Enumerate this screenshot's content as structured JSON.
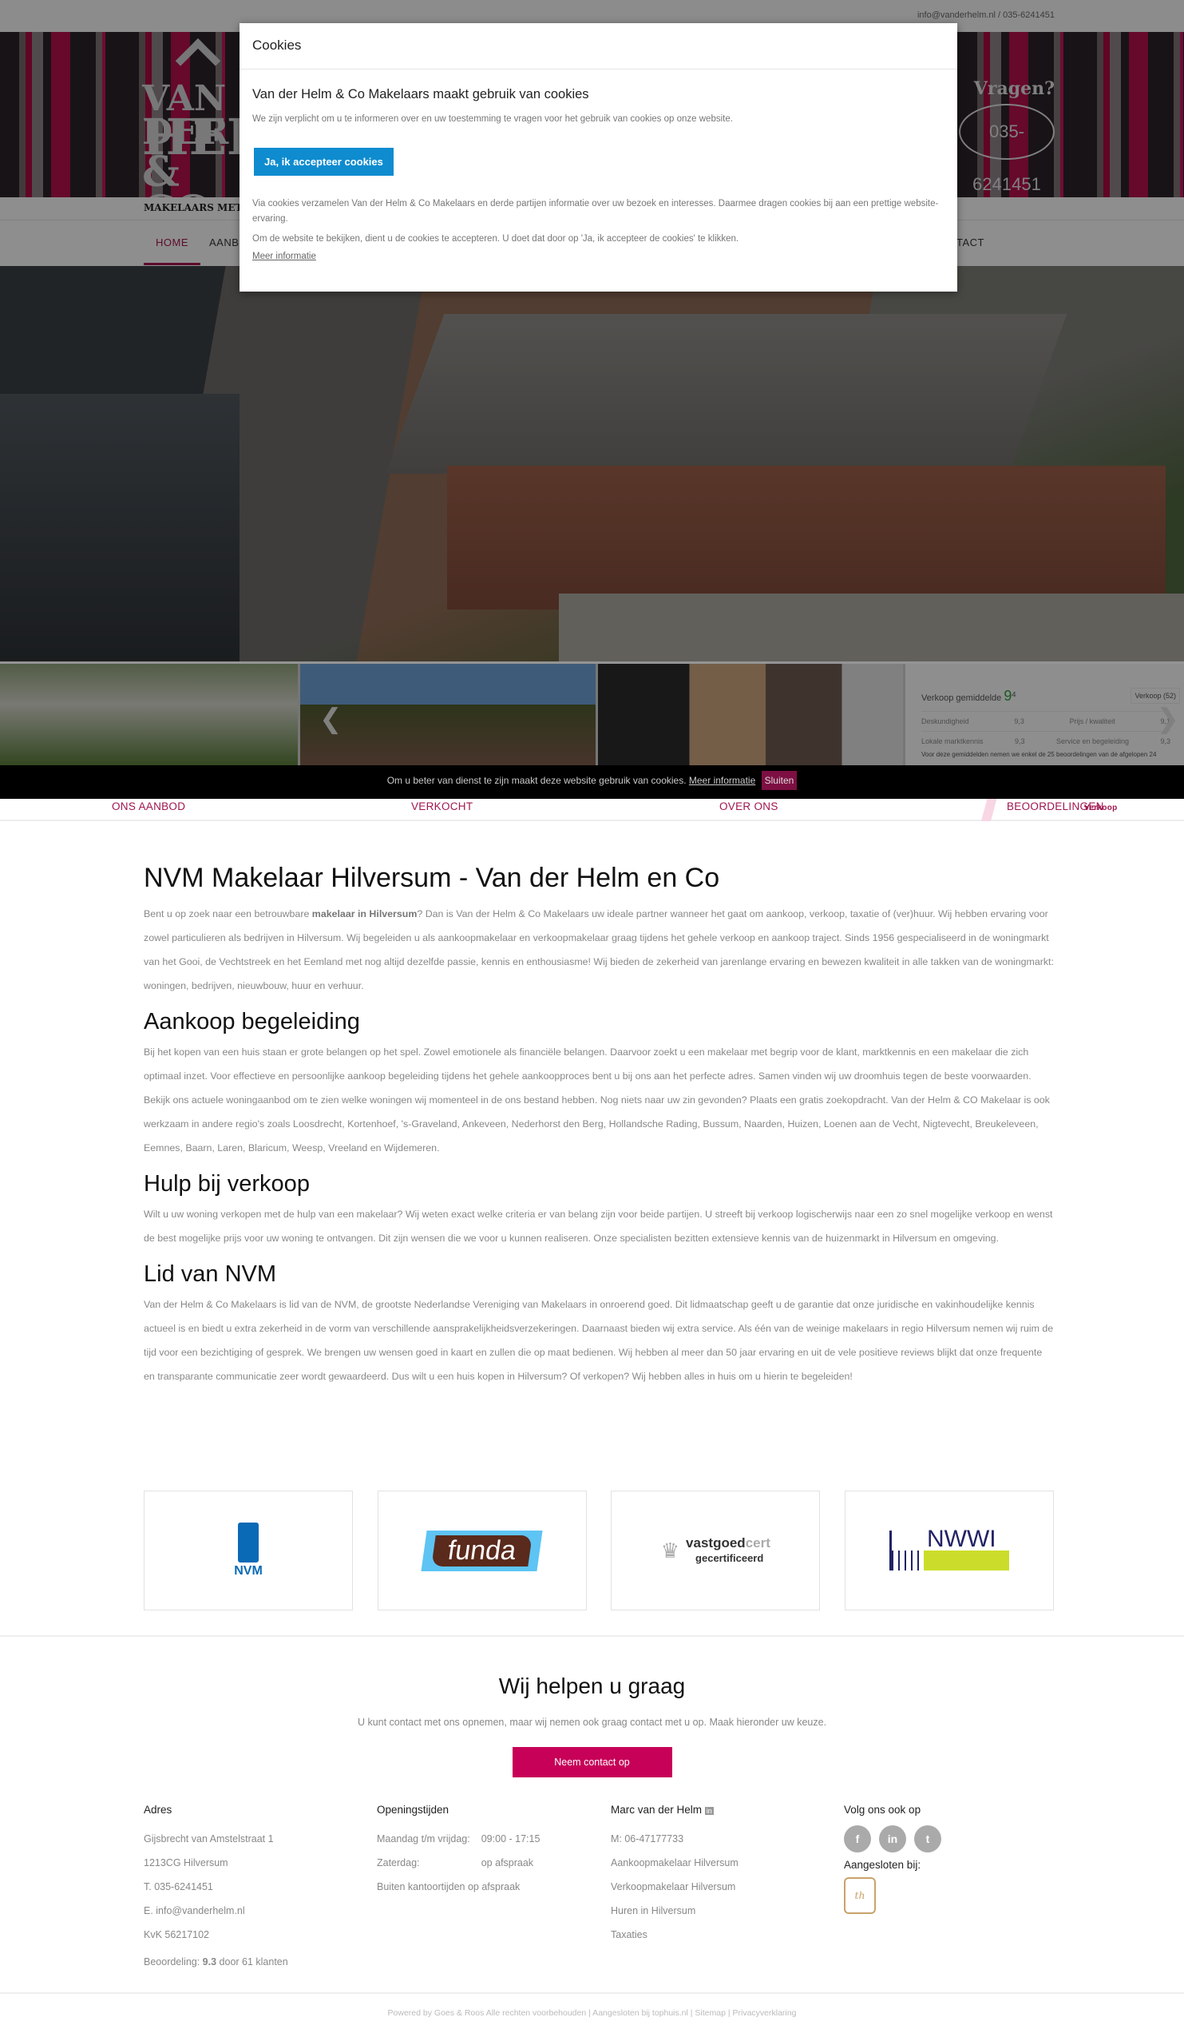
{
  "topbar": {
    "contact": "info@vanderhelm.nl / 035-6241451"
  },
  "header": {
    "logo_lines": [
      "VAN DER",
      "HELM",
      "& CO"
    ],
    "tagline": "MAKELAARS MET M",
    "vragen": "Vragen?",
    "phone": "035-6241451"
  },
  "nav": {
    "items": [
      "HOME",
      "AANB",
      "TACT"
    ]
  },
  "rating_widget": {
    "title": "Verkoop gemiddelde",
    "score": "9",
    "score_dec": "4",
    "tab": "Verkoop (52)",
    "rows": [
      [
        "Deskundigheid",
        "9,3",
        "Prijs / kwaliteit",
        "9,1"
      ],
      [
        "Lokale marktkennis",
        "9,3",
        "Service en begeleiding",
        "9,3"
      ]
    ],
    "note": "Voor deze gemiddelden nemen we enkel de 25 beoordelingen van de afgelopen 24"
  },
  "cookie_modal": {
    "title": "Cookies",
    "heading": "Van der Helm & Co Makelaars maakt gebruik van cookies",
    "intro": "We zijn verplicht om u te informeren over en uw toestemming te vragen voor het gebruik van cookies op onze website.",
    "accept": "Ja, ik accepteer cookies",
    "p1": "Via cookies verzamelen Van der Helm & Co Makelaars en derde partijen informatie over uw bezoek en interesses. Daarmee dragen cookies bij aan een prettige website-ervaring.",
    "p2": "Om de website te bekijken, dient u de cookies te accepteren. U doet dat door op 'Ja, ik accepteer de cookies' te klikken.",
    "more": "Meer informatie"
  },
  "cookie_bar": {
    "text": "Om u beter van dienst te zijn maakt deze website gebruik van cookies.",
    "more": "Meer informatie",
    "close": "Sluiten"
  },
  "slider_labels": [
    "ONS AANBOD",
    "VERKOCHT",
    "OVER ONS",
    "BEOORDELINGEN"
  ],
  "slider_badge": "Verkoop",
  "content": {
    "h1": "NVM Makelaar Hilversum - Van der Helm en Co",
    "p1_a": "Bent u op zoek naar een betrouwbare ",
    "p1_b": "makelaar in Hilversum",
    "p1_c": "? Dan is Van der Helm & Co Makelaars uw ideale partner wanneer het gaat om aankoop, verkoop, taxatie of (ver)huur. Wij hebben ervaring voor zowel particulieren als bedrijven in Hilversum. Wij begeleiden u als aankoopmakelaar en verkoopmakelaar graag tijdens het gehele verkoop en aankoop traject. Sinds 1956 gespecialiseerd in de woningmarkt van het Gooi, de Vechtstreek en het Eemland met nog altijd dezelfde passie, kennis en enthousiasme! Wij bieden de zekerheid van jarenlange ervaring en bewezen kwaliteit in alle takken van de woningmarkt: woningen, bedrijven, nieuwbouw, huur en verhuur.",
    "h2_1": "Aankoop begeleiding",
    "p2": "Bij het kopen van een huis staan er grote belangen op het spel. Zowel emotionele als financiële belangen. Daarvoor zoekt u een makelaar met begrip voor de klant, marktkennis en een makelaar die zich optimaal inzet. Voor effectieve en persoonlijke aankoop begeleiding tijdens het gehele aankoopproces bent u bij ons aan het perfecte adres. Samen vinden wij uw droomhuis tegen de beste voorwaarden. Bekijk ons actuele woningaanbod om te zien welke woningen wij momenteel in de ons bestand hebben. Nog niets naar uw zin gevonden? Plaats een gratis zoekopdracht. Van der Helm & CO Makelaar is ook werkzaam in andere regio's zoals Loosdrecht, Kortenhoef, 's-Graveland, Ankeveen, Nederhorst den Berg, Hollandsche Rading, Bussum, Naarden, Huizen, Loenen aan de Vecht, Nigtevecht, Breukeleveen, Eemnes, Baarn, Laren, Blaricum, Weesp, Vreeland en Wijdemeren.",
    "h2_2": "Hulp bij verkoop",
    "p3": "Wilt u uw woning verkopen met de hulp van een makelaar? Wij weten exact welke criteria er van belang zijn voor beide partijen. U streeft bij verkoop logischerwijs naar een zo snel mogelijke verkoop en wenst de best mogelijke prijs voor uw woning te ontvangen. Dit zijn wensen die we voor u kunnen realiseren. Onze specialisten bezitten extensieve kennis van de huizenmarkt in Hilversum en omgeving.",
    "h2_3": "Lid van NVM",
    "p4": "Van der Helm & Co Makelaars is lid van de NVM, de grootste Nederlandse Vereniging van Makelaars in onroerend goed. Dit lidmaatschap geeft u de garantie dat onze juridische en vakinhoudelijke kennis actueel is en biedt u extra zekerheid in de vorm van verschillende aansprakelijkheidsverzekeringen. Daarnaast bieden wij extra service. Als één van de weinige makelaars in regio Hilversum nemen wij ruim de tijd voor een bezichtiging of gesprek. We brengen uw wensen goed in kaart en zullen die op maat bedienen. Wij hebben al meer dan 50 jaar ervaring en uit de vele positieve reviews blijkt dat onze frequente en transparante communicatie zeer wordt gewaardeerd. Dus wilt u een huis kopen in Hilversum? Of verkopen? Wij hebben alles in huis om u hierin te begeleiden!"
  },
  "logos": {
    "nvm": "NVM",
    "funda": "funda",
    "vastgoed1": "vastgoed",
    "vastgoed2": "cert",
    "vastgoed3": "gecertificeerd",
    "nwwi": "NWWI"
  },
  "help": {
    "title": "Wij helpen u graag",
    "text": "U kunt contact met ons opnemen, maar wij nemen ook graag contact met u op. Maak hieronder uw keuze.",
    "button": "Neem contact op"
  },
  "footer": {
    "address": {
      "title": "Adres",
      "lines": [
        "Gijsbrecht van Amstelstraat 1",
        "1213CG Hilversum",
        "T. 035-6241451",
        "E. info@vanderhelm.nl",
        "KvK 56217102"
      ],
      "rating_label": "Beoordeling: ",
      "rating_value": "9.3",
      "rating_suffix": " door 61 klanten"
    },
    "hours": {
      "title": "Openingstijden",
      "rows": [
        [
          "Maandag t/m vrijdag:",
          "09:00 - 17:15"
        ],
        [
          "Zaterdag:",
          "op afspraak"
        ]
      ],
      "extra": "Buiten kantoortijden op afspraak"
    },
    "marc": {
      "title": "Marc van der Helm",
      "mobile": "M: 06-47177733",
      "links": [
        "Aankoopmakelaar Hilversum",
        "Verkoopmakelaar Hilversum",
        "Huren in Hilversum",
        "Taxaties"
      ]
    },
    "social": {
      "title": "Volg ons ook op",
      "icons": [
        "f",
        "in",
        "t"
      ],
      "affiliated": "Aangesloten bij:",
      "affiliate_logo": "th"
    },
    "copyright": "Powered by Goes & Roos Alle rechten voorbehouden | Aangesloten bij tophuis.nl | Sitemap | Privacyverklaring"
  },
  "colors": {
    "brand": "#a0154f",
    "cta": "#c70058",
    "accept": "#0e8ccf"
  }
}
